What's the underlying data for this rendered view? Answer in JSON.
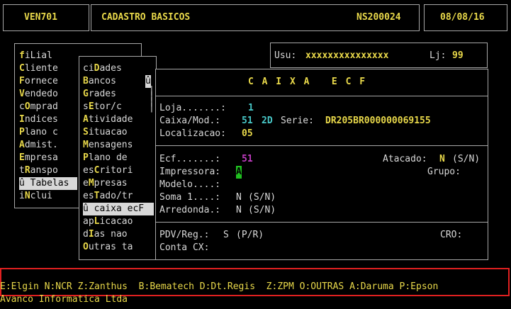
{
  "header": {
    "program": "VEN701",
    "title": "CADASTRO BASICOS",
    "terminal": "NS200024",
    "date": "08/08/16"
  },
  "user": {
    "label": "Usu:",
    "value": "xxxxxxxxxxxxxxx",
    "store_label": "Lj:",
    "store_value": "99"
  },
  "main_menu": [
    {
      "hot": "f",
      "pre": "",
      "rest": "iLial",
      "label": "fiLial"
    },
    {
      "hot": "C",
      "pre": "",
      "rest": "liente",
      "label": "Cliente"
    },
    {
      "hot": "F",
      "pre": "",
      "rest": "ornece",
      "label": "Fornece"
    },
    {
      "hot": "V",
      "pre": "",
      "rest": "endedo",
      "label": "Vendedo"
    },
    {
      "hot": "O",
      "pre": "c",
      "rest": "mprad",
      "label": "cOmprad"
    },
    {
      "hot": "I",
      "pre": "",
      "rest": "ndices",
      "label": "Indices"
    },
    {
      "hot": "P",
      "pre": "",
      "rest": "lano c",
      "label": "Plano c"
    },
    {
      "hot": "A",
      "pre": "",
      "rest": "dmist.",
      "label": "Admist."
    },
    {
      "hot": "E",
      "pre": "",
      "rest": "mpresa",
      "label": "Empresa"
    },
    {
      "hot": "R",
      "pre": "t",
      "rest": "anspo",
      "label": "tRanspo"
    },
    {
      "hot": "T",
      "pre": "û ",
      "rest": "abelas",
      "label": "û Tabelas",
      "selected": true
    },
    {
      "hot": "N",
      "pre": "i",
      "rest": "clui",
      "label": "iNclui"
    }
  ],
  "sub_menu": [
    {
      "pre": "ci",
      "hot": "D",
      "rest": "ades"
    },
    {
      "pre": "",
      "hot": "B",
      "rest": "ancos"
    },
    {
      "pre": "",
      "hot": "G",
      "rest": "rades"
    },
    {
      "pre": "s",
      "hot": "E",
      "rest": "tor/c"
    },
    {
      "pre": "",
      "hot": "A",
      "rest": "tividade"
    },
    {
      "pre": "",
      "hot": "S",
      "rest": "ituacao"
    },
    {
      "pre": "",
      "hot": "M",
      "rest": "ensagens"
    },
    {
      "pre": "",
      "hot": "P",
      "rest": "lano de"
    },
    {
      "pre": "es",
      "hot": "C",
      "rest": "ritori"
    },
    {
      "pre": "e",
      "hot": "M",
      "rest": "presas"
    },
    {
      "pre": "es",
      "hot": "T",
      "rest": "ado/tr"
    },
    {
      "pre": "û ",
      "hot": "c",
      "rest": "aixa ecF",
      "selected": true
    },
    {
      "pre": "ap",
      "hot": "L",
      "rest": "icacao"
    },
    {
      "pre": "d",
      "hot": "I",
      "rest": "as nao"
    },
    {
      "pre": "",
      "hot": "O",
      "rest": "utras ta"
    }
  ],
  "scroll_glyph": "û",
  "form": {
    "title": "C A I X A   E C F",
    "loja_label": "Loja.......:",
    "loja_value": "1",
    "caixa_label": "Caixa/Mod.:",
    "caixa_value": "51",
    "mod_value": "2D",
    "serie_label": "Serie:",
    "serie_value": "DR205BR000000069155",
    "local_label": "Localizacao:",
    "local_value": "05",
    "ecf_label": "Ecf.......:",
    "ecf_value": "51",
    "atacado_label": "Atacado:",
    "atacado_value": "N",
    "atacado_hint": "(S/N)",
    "impressora_label": "Impressora:",
    "impressora_value": "A",
    "grupo_label": "Grupo:",
    "modelo_label": "Modelo....:",
    "soma_label": "Soma 1....:",
    "soma_value": "N",
    "soma_hint": "(S/N)",
    "arred_label": "Arredonda.:",
    "arred_value": "N",
    "arred_hint": "(S/N)",
    "pdv_label": "PDV/Reg.:",
    "pdv_value": "S",
    "pdv_hint": "(P/R)",
    "cro_label": "CRO:",
    "conta_label": "Conta CX:"
  },
  "help_line": "E:Elgin N:NCR Z:Zanthus  B:Bematech D:Dt.Regis  Z:ZPM O:OUTRAS A:Daruma P:Epson",
  "footer": "Avanco Informatica Ltda",
  "colors": {
    "yellow": "#e8d84a",
    "cyan": "#48c8c8",
    "magenta": "#c03cc0",
    "highlight": "#e02020"
  }
}
